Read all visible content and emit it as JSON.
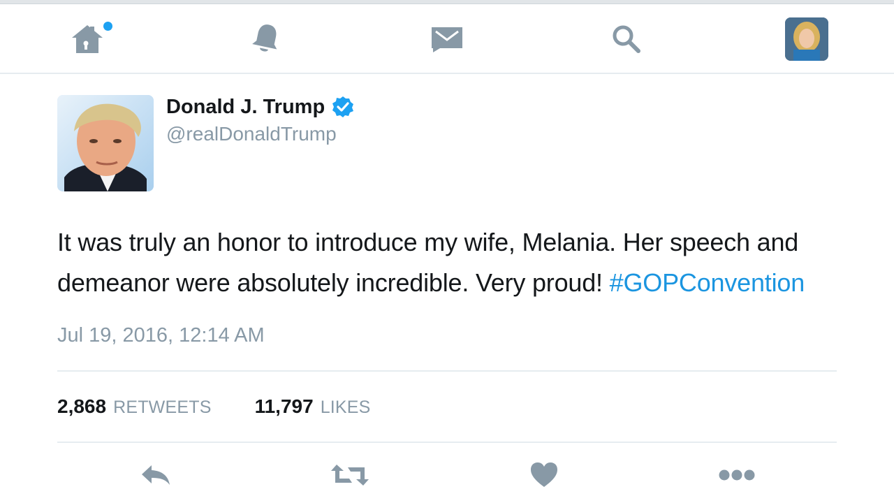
{
  "nav": {
    "items": [
      {
        "icon": "home-icon",
        "has_notification_dot": true
      },
      {
        "icon": "bell-icon"
      },
      {
        "icon": "envelope-icon"
      },
      {
        "icon": "search-icon"
      },
      {
        "icon": "profile-avatar"
      }
    ],
    "accent_color": "#1da1f2",
    "icon_color": "#8899a6"
  },
  "tweet": {
    "author": {
      "name": "Donald J. Trump",
      "handle": "@realDonaldTrump",
      "verified": true
    },
    "text": "It was truly an honor to introduce my wife, Melania. Her speech and demeanor were absolutely incredible. Very proud!",
    "hashtag": "#GOPConvention",
    "timestamp": "Jul 19, 2016, 12:14 AM",
    "stats": {
      "retweets_count": "2,868",
      "retweets_label": "RETWEETS",
      "likes_count": "11,797",
      "likes_label": "LIKES"
    },
    "link_color": "#1b95e0"
  },
  "actions": [
    {
      "icon": "reply-icon"
    },
    {
      "icon": "retweet-icon"
    },
    {
      "icon": "heart-icon"
    },
    {
      "icon": "more-icon"
    }
  ]
}
